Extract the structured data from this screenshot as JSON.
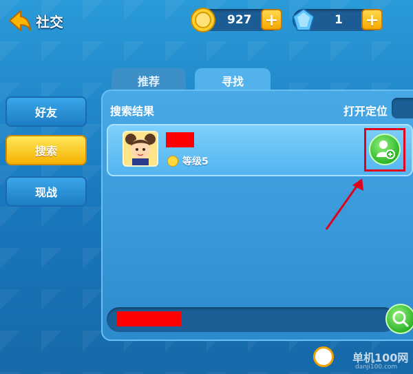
{
  "header": {
    "title": "社交",
    "coins": "927",
    "gems": "1"
  },
  "sidebar": {
    "items": [
      {
        "label": "好友"
      },
      {
        "label": "搜索"
      },
      {
        "label": "现战"
      }
    ],
    "active": "搜索"
  },
  "tabs": [
    {
      "label": "推荐"
    },
    {
      "label": "寻找"
    }
  ],
  "panel": {
    "results_label": "搜索结果",
    "location_label": "打开定位"
  },
  "result": {
    "name": "",
    "level": "等级5"
  },
  "search": {
    "value": ""
  },
  "watermark": {
    "text": "单机100网",
    "sub": "danji100.com"
  },
  "colors": {
    "background": "#1e80c6",
    "active_nav": "#f6b200",
    "add_button": "#2fb52a",
    "highlight_outline": "#e0001b"
  },
  "icons": [
    "back-arrow-icon",
    "coin-icon",
    "gem-icon",
    "plus-icon",
    "add-friend-icon",
    "search-icon"
  ]
}
